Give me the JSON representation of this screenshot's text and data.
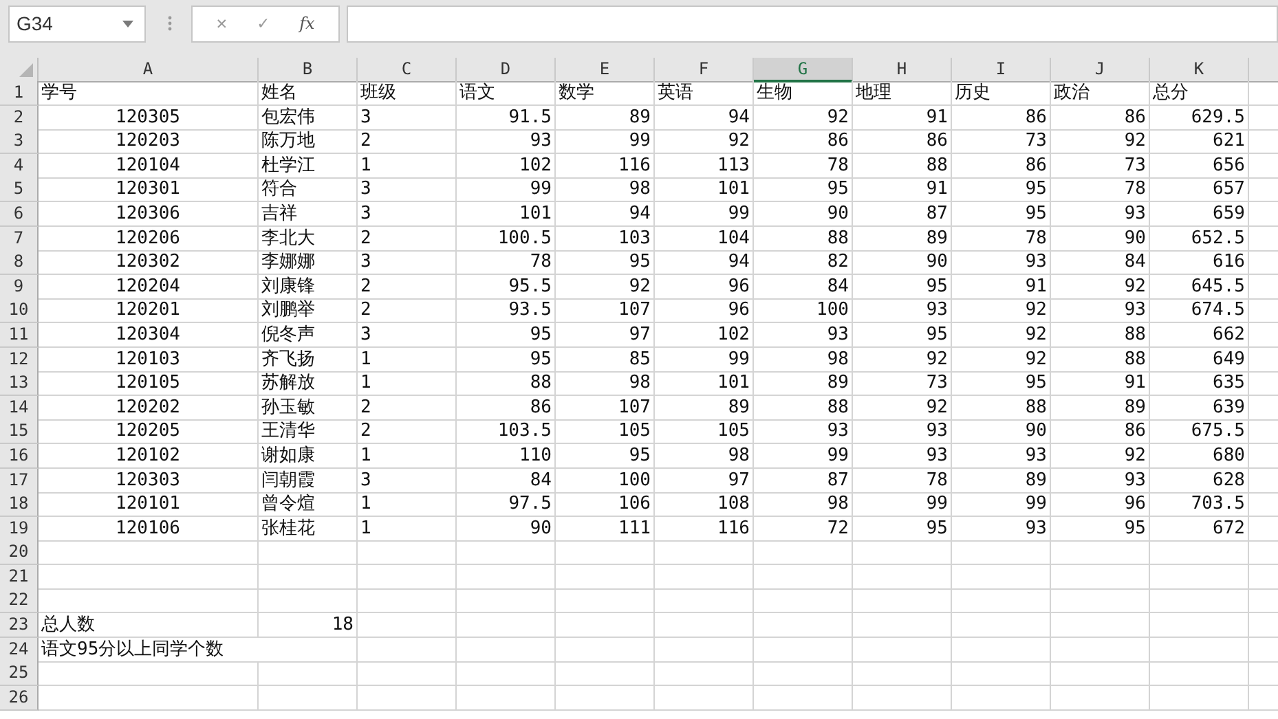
{
  "name_box": {
    "value": "G34"
  },
  "formula_bar": {
    "cancel": "✕",
    "enter": "✓",
    "function": "fx"
  },
  "columns": [
    {
      "label": "A",
      "selected": false
    },
    {
      "label": "B",
      "selected": false
    },
    {
      "label": "C",
      "selected": false
    },
    {
      "label": "D",
      "selected": false
    },
    {
      "label": "E",
      "selected": false
    },
    {
      "label": "F",
      "selected": false
    },
    {
      "label": "G",
      "selected": true
    },
    {
      "label": "H",
      "selected": false
    },
    {
      "label": "I",
      "selected": false
    },
    {
      "label": "J",
      "selected": false
    },
    {
      "label": "K",
      "selected": false
    }
  ],
  "rows": [
    {
      "number": "1",
      "kind": "header",
      "cells": [
        "学号",
        "姓名",
        "班级",
        "语文",
        "数学",
        "英语",
        "生物",
        "地理",
        "历史",
        "政治",
        "总分"
      ]
    },
    {
      "number": "2",
      "kind": "record",
      "cells": [
        "120305",
        "包宏伟",
        "3",
        "91.5",
        "89",
        "94",
        "92",
        "91",
        "86",
        "86",
        "629.5"
      ]
    },
    {
      "number": "3",
      "kind": "record",
      "cells": [
        "120203",
        "陈万地",
        "2",
        "93",
        "99",
        "92",
        "86",
        "86",
        "73",
        "92",
        "621"
      ]
    },
    {
      "number": "4",
      "kind": "record",
      "cells": [
        "120104",
        "杜学江",
        "1",
        "102",
        "116",
        "113",
        "78",
        "88",
        "86",
        "73",
        "656"
      ]
    },
    {
      "number": "5",
      "kind": "record",
      "cells": [
        "120301",
        "符合",
        "3",
        "99",
        "98",
        "101",
        "95",
        "91",
        "95",
        "78",
        "657"
      ]
    },
    {
      "number": "6",
      "kind": "record",
      "cells": [
        "120306",
        "吉祥",
        "3",
        "101",
        "94",
        "99",
        "90",
        "87",
        "95",
        "93",
        "659"
      ]
    },
    {
      "number": "7",
      "kind": "record",
      "cells": [
        "120206",
        "李北大",
        "2",
        "100.5",
        "103",
        "104",
        "88",
        "89",
        "78",
        "90",
        "652.5"
      ]
    },
    {
      "number": "8",
      "kind": "record",
      "cells": [
        "120302",
        "李娜娜",
        "3",
        "78",
        "95",
        "94",
        "82",
        "90",
        "93",
        "84",
        "616"
      ]
    },
    {
      "number": "9",
      "kind": "record",
      "cells": [
        "120204",
        "刘康锋",
        "2",
        "95.5",
        "92",
        "96",
        "84",
        "95",
        "91",
        "92",
        "645.5"
      ]
    },
    {
      "number": "10",
      "kind": "record",
      "cells": [
        "120201",
        "刘鹏举",
        "2",
        "93.5",
        "107",
        "96",
        "100",
        "93",
        "92",
        "93",
        "674.5"
      ]
    },
    {
      "number": "11",
      "kind": "record",
      "cells": [
        "120304",
        "倪冬声",
        "3",
        "95",
        "97",
        "102",
        "93",
        "95",
        "92",
        "88",
        "662"
      ]
    },
    {
      "number": "12",
      "kind": "record",
      "cells": [
        "120103",
        "齐飞扬",
        "1",
        "95",
        "85",
        "99",
        "98",
        "92",
        "92",
        "88",
        "649"
      ]
    },
    {
      "number": "13",
      "kind": "record",
      "cells": [
        "120105",
        "苏解放",
        "1",
        "88",
        "98",
        "101",
        "89",
        "73",
        "95",
        "91",
        "635"
      ]
    },
    {
      "number": "14",
      "kind": "record",
      "cells": [
        "120202",
        "孙玉敏",
        "2",
        "86",
        "107",
        "89",
        "88",
        "92",
        "88",
        "89",
        "639"
      ]
    },
    {
      "number": "15",
      "kind": "record",
      "cells": [
        "120205",
        "王清华",
        "2",
        "103.5",
        "105",
        "105",
        "93",
        "93",
        "90",
        "86",
        "675.5"
      ]
    },
    {
      "number": "16",
      "kind": "record",
      "cells": [
        "120102",
        "谢如康",
        "1",
        "110",
        "95",
        "98",
        "99",
        "93",
        "93",
        "92",
        "680"
      ]
    },
    {
      "number": "17",
      "kind": "record",
      "cells": [
        "120303",
        "闫朝霞",
        "3",
        "84",
        "100",
        "97",
        "87",
        "78",
        "89",
        "93",
        "628"
      ]
    },
    {
      "number": "18",
      "kind": "record",
      "cells": [
        "120101",
        "曾令煊",
        "1",
        "97.5",
        "106",
        "108",
        "98",
        "99",
        "99",
        "96",
        "703.5"
      ]
    },
    {
      "number": "19",
      "kind": "record",
      "cells": [
        "120106",
        "张桂花",
        "1",
        "90",
        "111",
        "116",
        "72",
        "95",
        "93",
        "95",
        "672"
      ]
    },
    {
      "number": "20",
      "kind": "blank",
      "cells": []
    },
    {
      "number": "21",
      "kind": "blank",
      "cells": []
    },
    {
      "number": "22",
      "kind": "blank",
      "cells": []
    },
    {
      "number": "23",
      "kind": "summary",
      "cells": [
        "总人数",
        "18"
      ]
    },
    {
      "number": "24",
      "kind": "summary",
      "cells": [
        "语文95分以上同学个数"
      ]
    },
    {
      "number": "25",
      "kind": "blank",
      "cells": []
    },
    {
      "number": "26",
      "kind": "blank",
      "cells": []
    }
  ]
}
